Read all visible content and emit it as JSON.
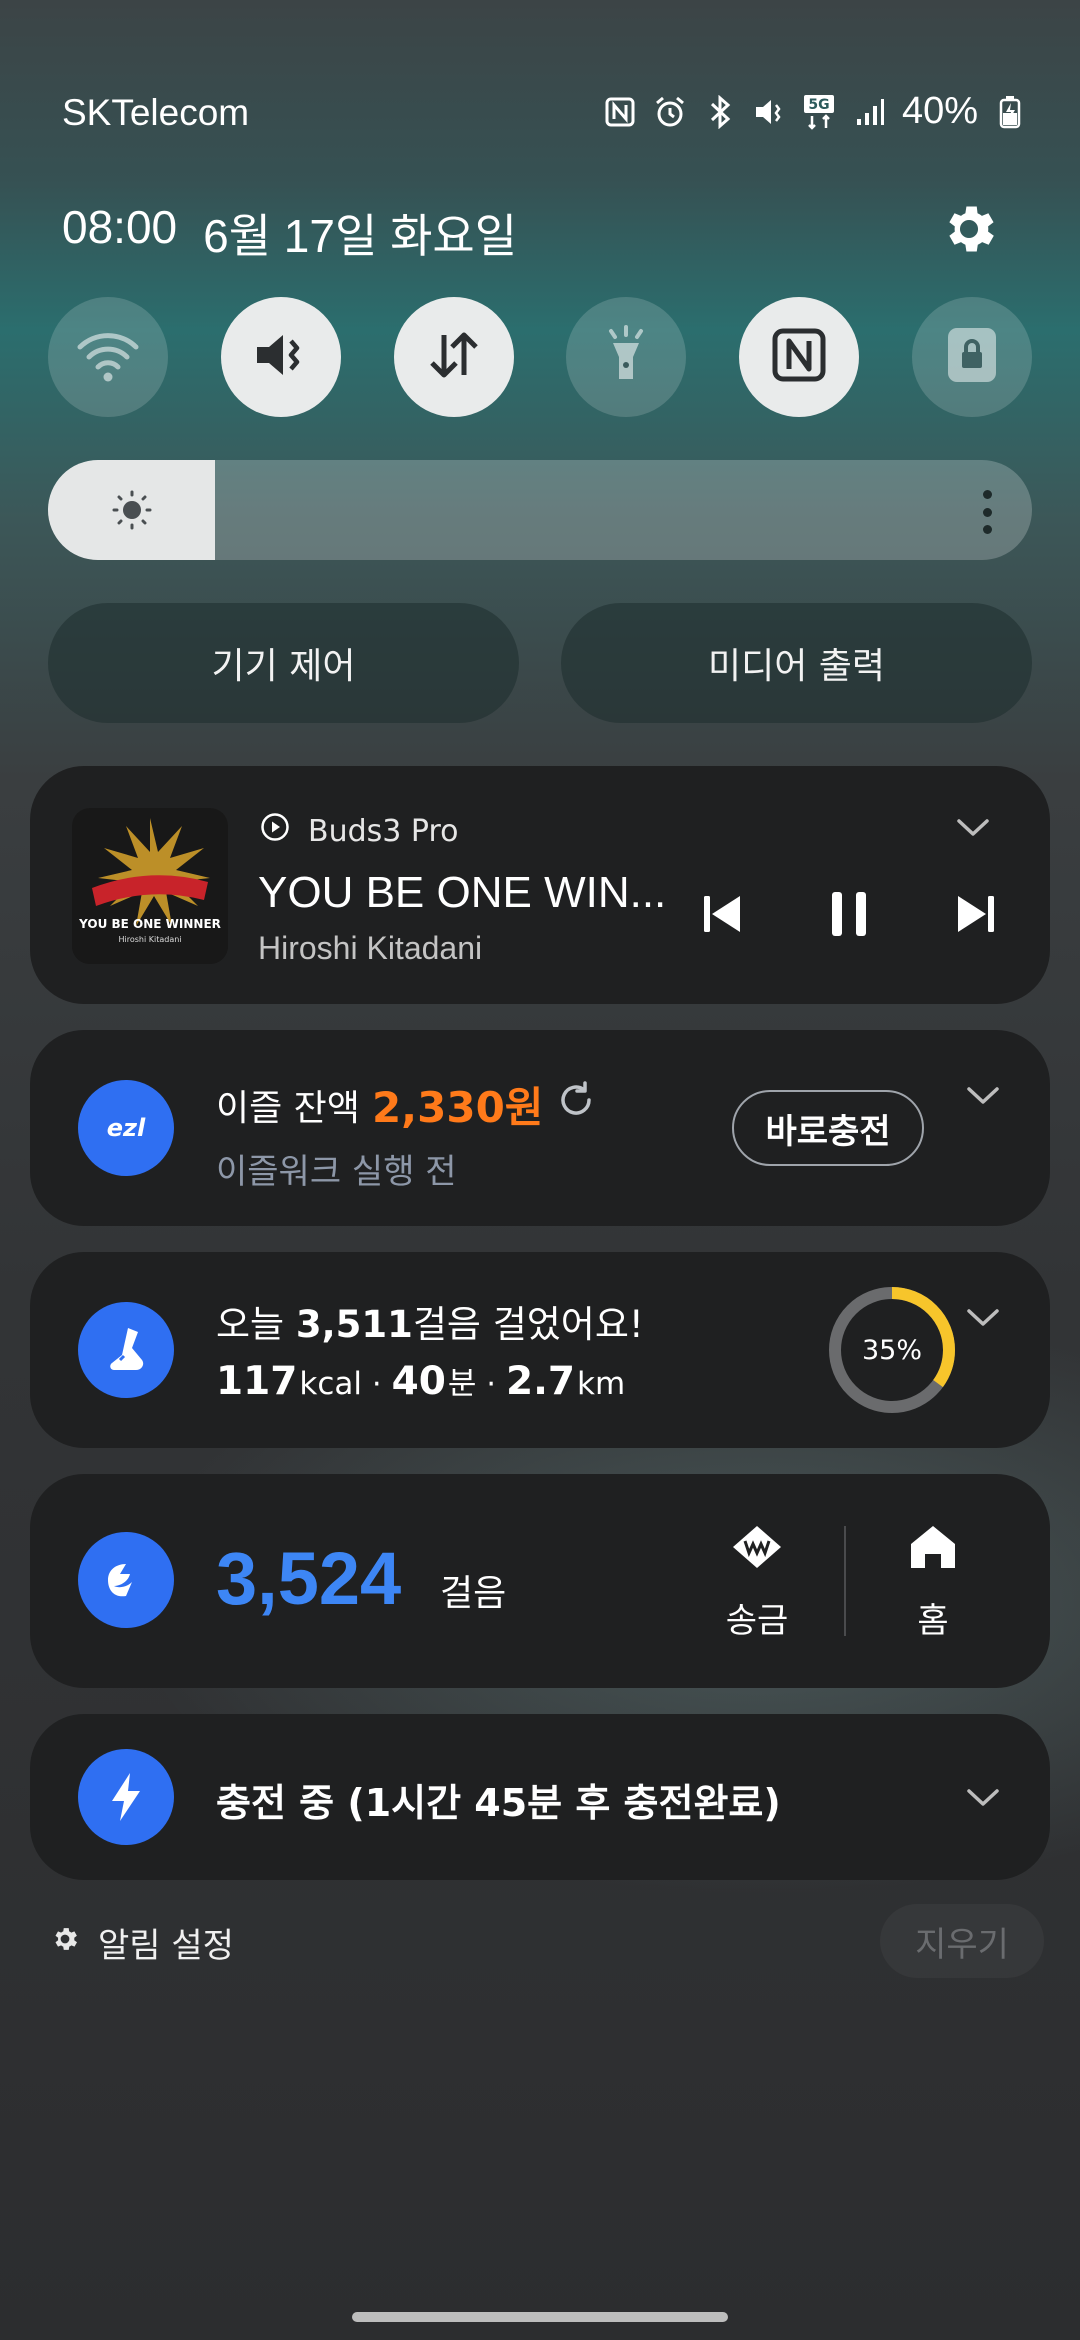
{
  "status_bar": {
    "carrier": "SKTelecom",
    "battery": "40%",
    "icons": [
      "nfc-icon",
      "alarm-icon",
      "bluetooth-icon",
      "mute-icon",
      "5g-icon",
      "signal-icon",
      "battery-charging-icon"
    ]
  },
  "header": {
    "time": "08:00",
    "date": "6월 17일 화요일"
  },
  "quick_toggles": [
    {
      "name": "wifi",
      "icon": "wifi-icon",
      "state": "off"
    },
    {
      "name": "sound",
      "icon": "mute-icon",
      "state": "on"
    },
    {
      "name": "mobile-data",
      "icon": "data-arrows-icon",
      "state": "on"
    },
    {
      "name": "flashlight",
      "icon": "flashlight-icon",
      "state": "off"
    },
    {
      "name": "nfc",
      "icon": "nfc-icon",
      "state": "on"
    },
    {
      "name": "secure-folder",
      "icon": "lock-icon",
      "state": "off"
    }
  ],
  "brightness": {
    "level": 0.25
  },
  "buttons": {
    "device_control": "기기 제어",
    "media_output": "미디어 출력"
  },
  "media": {
    "source": "Buds3 Pro",
    "title": "YOU BE ONE WIN...",
    "artist": "Hiroshi Kitadani"
  },
  "ezl": {
    "label": "이즐 잔액",
    "amount": "2,330원",
    "status": "이즐워크 실행 전",
    "charge_button": "바로충전",
    "logo_text": "ezl"
  },
  "steps": {
    "prefix": "오늘 ",
    "count": "3,511",
    "suffix": "걸음 걸었어요!",
    "kcal": "117",
    "kcal_unit": "kcal",
    "minutes": "40",
    "minutes_unit": "분",
    "km": "2.7",
    "km_unit": "km",
    "progress_label": "35%",
    "progress": 0.35
  },
  "toss": {
    "count": "3,524",
    "unit": "걸음",
    "send_label": "송금",
    "home_label": "홈"
  },
  "charging": {
    "text": "충전 중 (1시간 45분 후 충전완료)"
  },
  "footer": {
    "notification_settings": "알림 설정",
    "clear": "지우기"
  },
  "colors": {
    "accent_blue": "#2f6ff2",
    "toss_blue": "#3d86f5",
    "ezl_orange": "#ff7a1a",
    "ring_yellow": "#f7c52b",
    "card_bg": "#1f2021"
  }
}
